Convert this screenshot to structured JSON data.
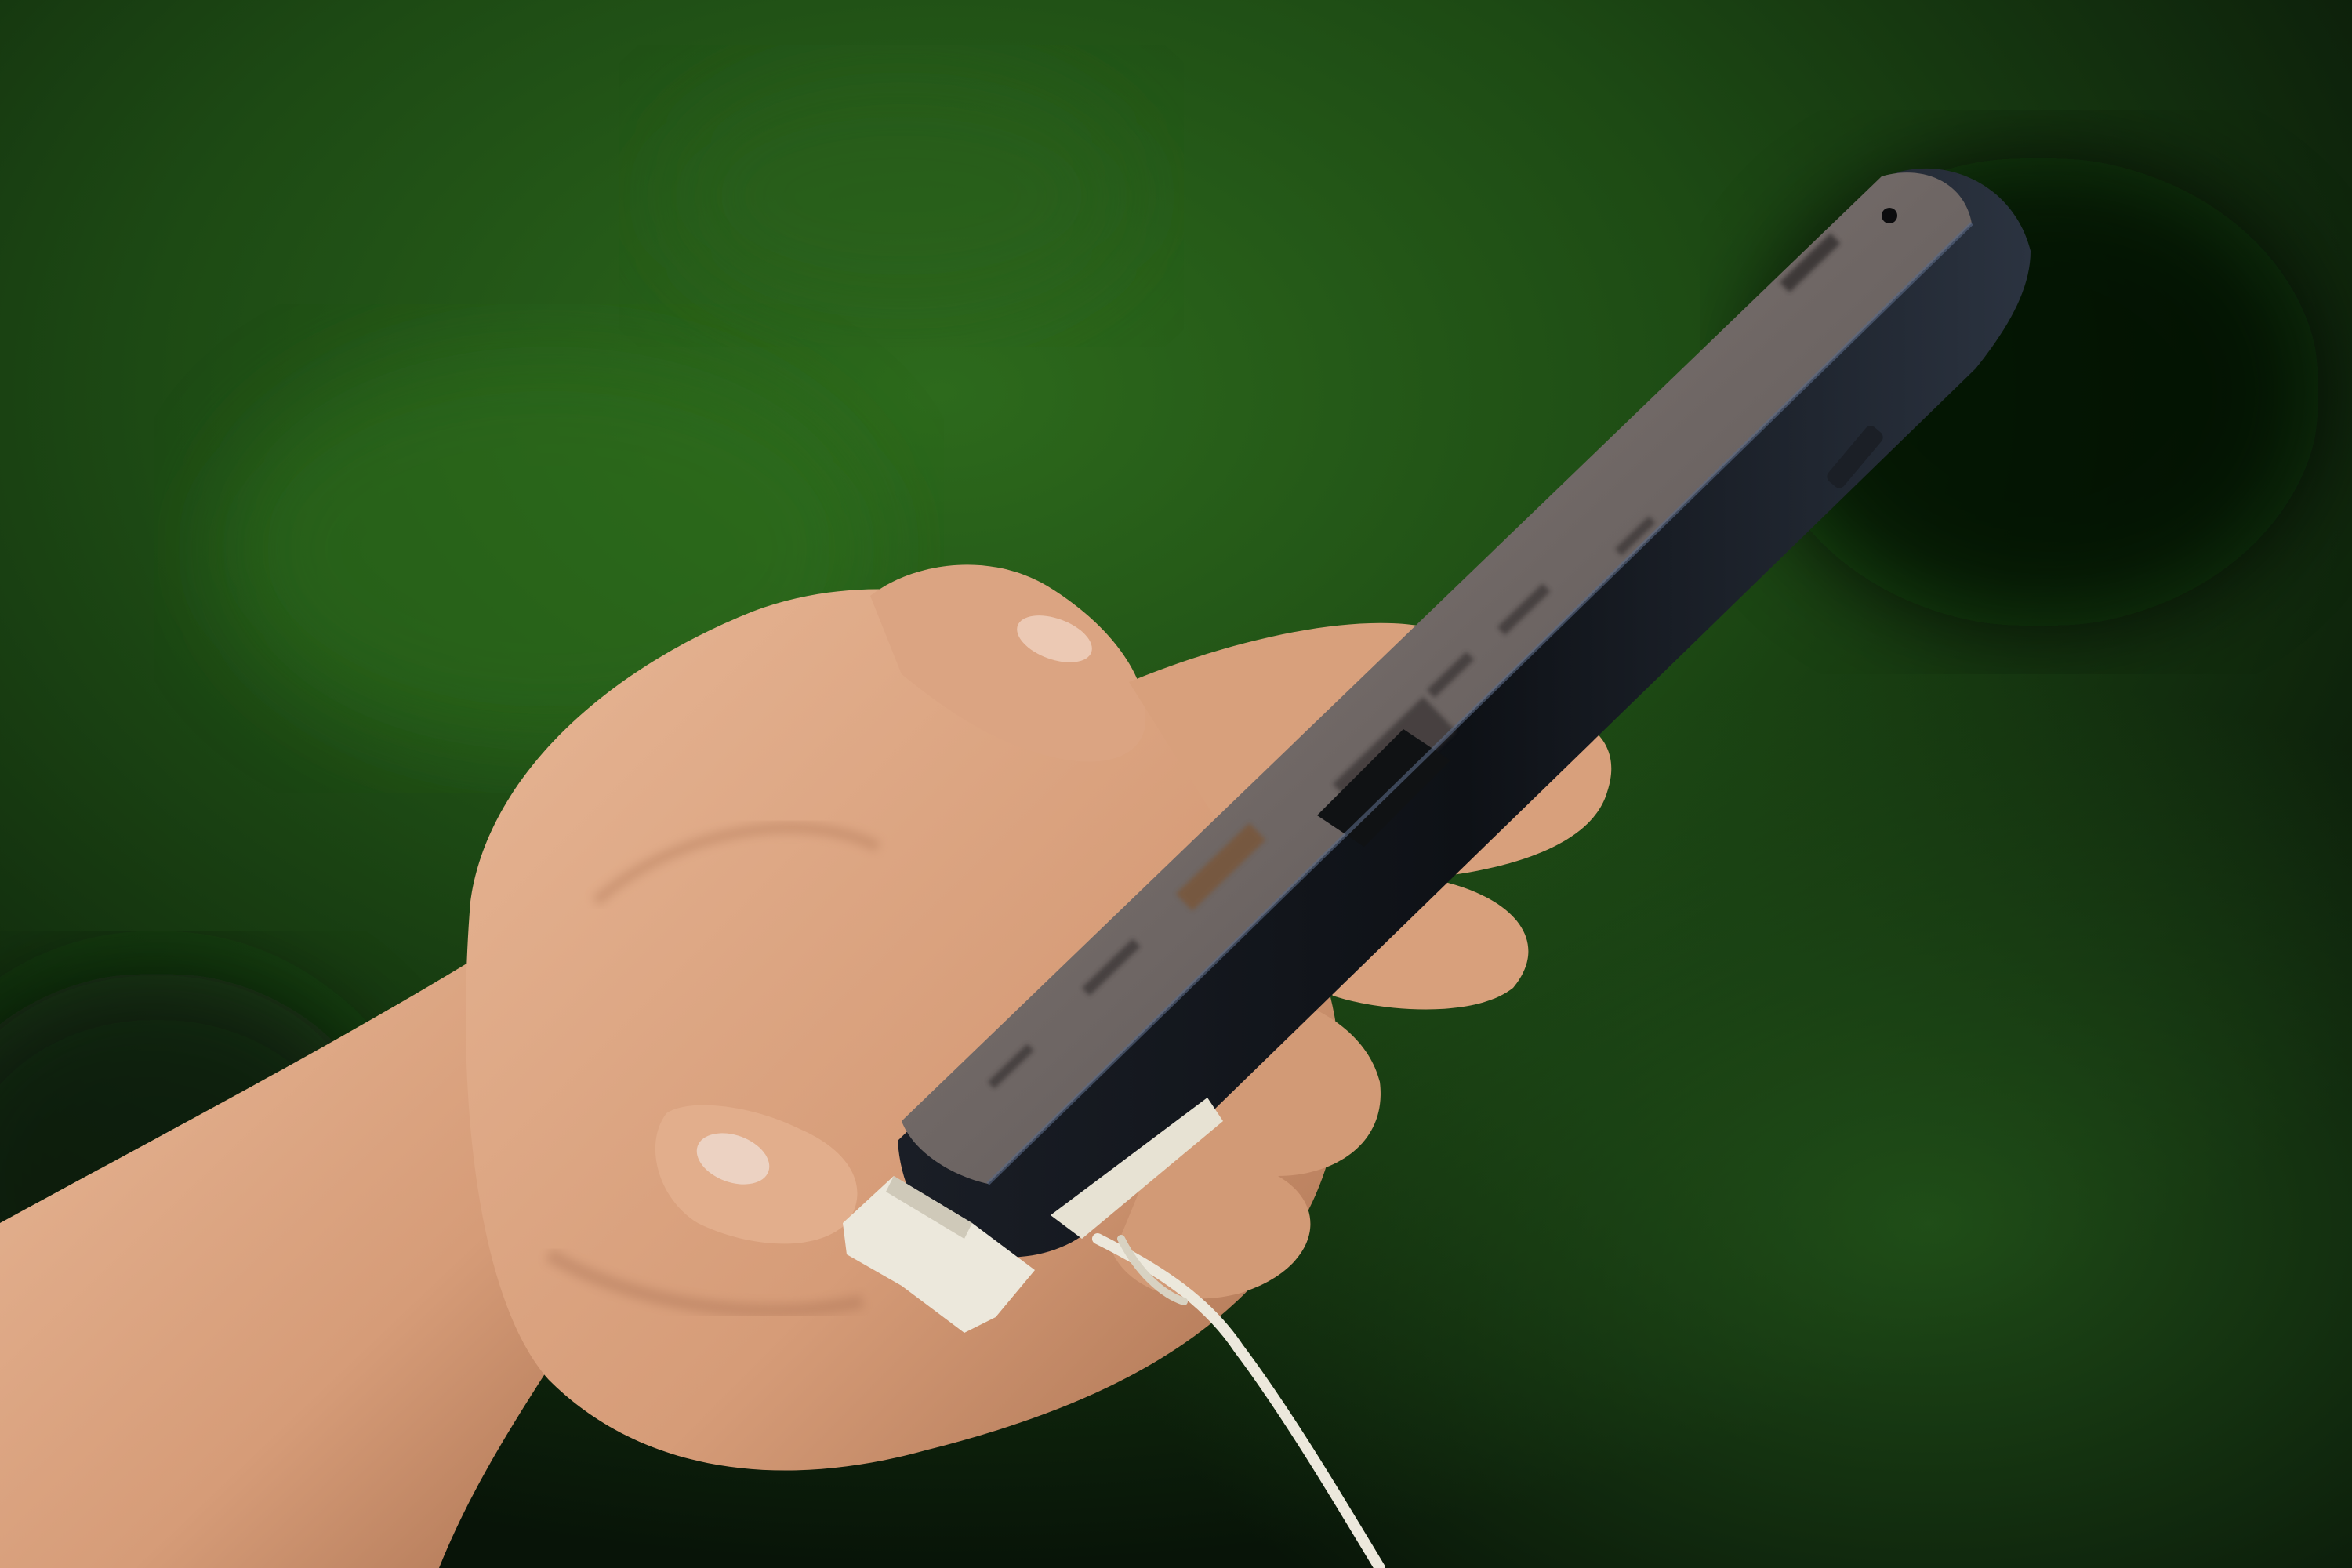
{
  "photo": {
    "colors": {
      "background_dark": "#081408",
      "background_mid": "#1d4a14",
      "background_light": "#2d6a1c",
      "skin": "#e0ad8c",
      "skin_shadow": "#a9704f",
      "phone_body": "#0e1116",
      "phone_screen": "#6e6664",
      "cable": "#ece8dc"
    },
    "objects": [
      "hand",
      "smartphone",
      "security-tether-clip",
      "charging-cable"
    ]
  }
}
